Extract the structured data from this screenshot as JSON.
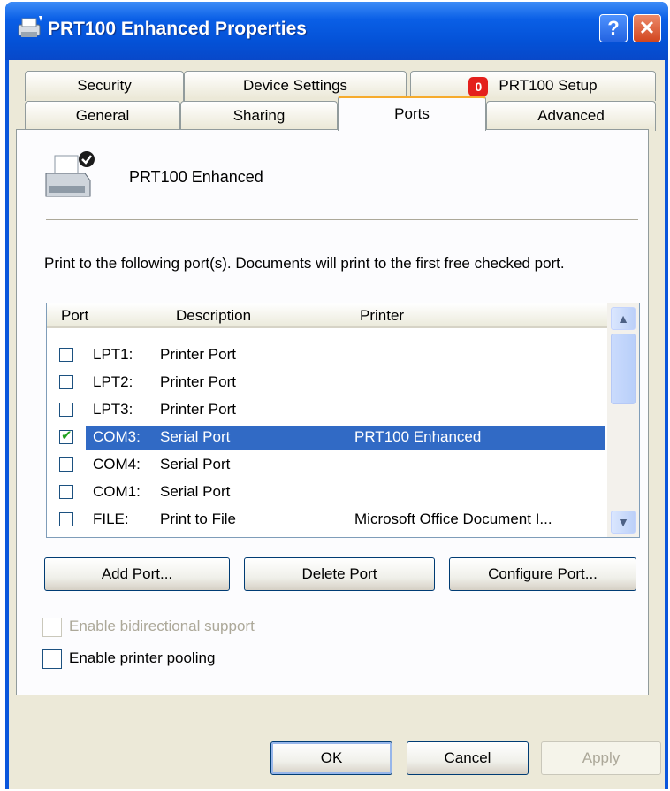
{
  "window": {
    "title": "PRT100 Enhanced Properties",
    "help_label": "?",
    "close_label": "✕",
    "colors": {
      "titlebar": "#0a56dc",
      "selection": "#316ac5",
      "active_tab_accent": "#f6ab2d"
    }
  },
  "tabs": {
    "row1": [
      {
        "label": "Security"
      },
      {
        "label": "Device Settings"
      },
      {
        "label": "PRT100 Setup",
        "badge": "0"
      }
    ],
    "row2": [
      {
        "label": "General"
      },
      {
        "label": "Sharing"
      },
      {
        "label": "Ports",
        "active": true
      },
      {
        "label": "Advanced"
      }
    ]
  },
  "printer": {
    "name": "PRT100 Enhanced"
  },
  "info_text": "Print to the following port(s). Documents will print to the first free checked port.",
  "port_list": {
    "columns": [
      "Port",
      "Description",
      "Printer"
    ],
    "rows": [
      {
        "port": "LPT1:",
        "description": "Printer Port",
        "printer": "",
        "checked": false
      },
      {
        "port": "LPT2:",
        "description": "Printer Port",
        "printer": "",
        "checked": false
      },
      {
        "port": "LPT3:",
        "description": "Printer Port",
        "printer": "",
        "checked": false
      },
      {
        "port": "COM3:",
        "description": "Serial Port",
        "printer": "PRT100 Enhanced",
        "checked": true,
        "selected": true
      },
      {
        "port": "COM4:",
        "description": "Serial Port",
        "printer": "",
        "checked": false
      },
      {
        "port": "COM1:",
        "description": "Serial Port",
        "printer": "",
        "checked": false
      },
      {
        "port": "FILE:",
        "description": "Print to File",
        "printer": "Microsoft Office Document I...",
        "checked": false
      }
    ]
  },
  "port_buttons": {
    "add": "Add Port...",
    "delete": "Delete Port",
    "configure": "Configure Port..."
  },
  "options": {
    "bidirectional": {
      "label": "Enable bidirectional support",
      "checked": false,
      "enabled": false
    },
    "pooling": {
      "label": "Enable printer pooling",
      "checked": false,
      "enabled": true
    }
  },
  "dialog_buttons": {
    "ok": "OK",
    "cancel": "Cancel",
    "apply": "Apply"
  }
}
